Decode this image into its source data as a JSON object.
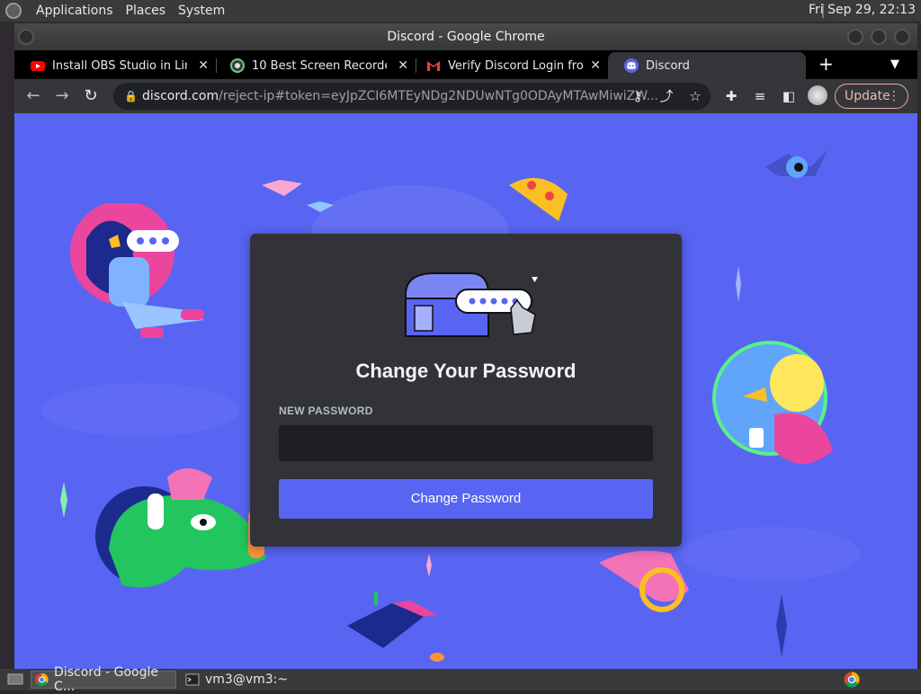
{
  "panel": {
    "menus": [
      "Applications",
      "Places",
      "System"
    ],
    "clock": "Fri Sep 29, 22:13"
  },
  "window": {
    "title": "Discord - Google Chrome"
  },
  "tabs": [
    {
      "title": "Install OBS Studio in Linux",
      "icon": "youtube-icon",
      "active": false
    },
    {
      "title": "10 Best Screen Recorders f",
      "icon": "obs-icon",
      "active": false
    },
    {
      "title": "Verify Discord Login from N",
      "icon": "gmail-icon",
      "active": false
    },
    {
      "title": "Discord",
      "icon": "discord-icon",
      "active": true
    }
  ],
  "toolbar": {
    "url_host": "discord.com",
    "url_rest": "/reject-ip#token=eyJpZCI6MTEyNDg2NDUwNTg0ODAyMTAwMiwiZW...",
    "update_label": "Update"
  },
  "modal": {
    "title": "Change Your Password",
    "new_password_label": "NEW PASSWORD",
    "new_password_value": "",
    "submit_label": "Change Password"
  },
  "taskbar": {
    "items": [
      "Discord - Google C...",
      "vm3@vm3:~"
    ]
  },
  "colors": {
    "page_bg": "#5865f2",
    "modal_bg": "#313338",
    "input_bg": "#1e1f22",
    "button_bg": "#5865f2"
  }
}
